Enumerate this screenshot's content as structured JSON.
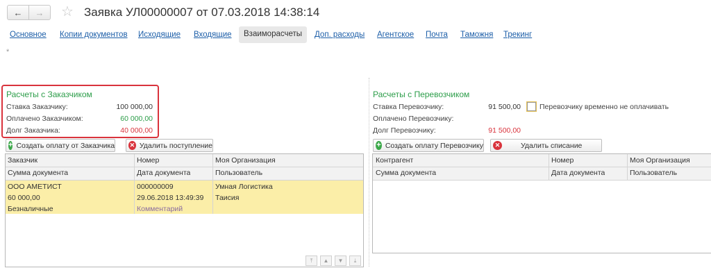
{
  "header": {
    "back_glyph": "←",
    "forward_glyph": "→",
    "star_glyph": "☆",
    "title": "Заявка УЛ00000007 от 07.03.2018 14:38:14"
  },
  "tabs": [
    {
      "label": "Основное"
    },
    {
      "label": "Копии документов"
    },
    {
      "label": "Исходящие"
    },
    {
      "label": "Входящие"
    },
    {
      "label": "Взаиморасчеты",
      "active": true
    },
    {
      "label": "Доп. расходы"
    },
    {
      "label": "Агентское"
    },
    {
      "label": "Почта"
    },
    {
      "label": "Таможня"
    },
    {
      "label": "Трекинг"
    }
  ],
  "asterisk": "*",
  "customer": {
    "title": "Расчеты с Заказчиком",
    "rate_label": "Ставка Заказчику:",
    "rate_value": "100 000,00",
    "paid_label": "Оплачено Заказчиком:",
    "paid_value": "60 000,00",
    "debt_label": "Долг Заказчика:",
    "debt_value": "40 000,00",
    "create_payment_button": "Создать оплату от Заказчика",
    "delete_receipt_button": "Удалить поступление",
    "columns_row1": [
      "Заказчик",
      "Номер",
      "Моя Организация"
    ],
    "columns_row2": [
      "Сумма документа",
      "Дата документа",
      "Пользователь"
    ],
    "record": {
      "customer": "ООО АМЕТИСТ",
      "number": "000000009",
      "organization": "Умная Логистика",
      "amount": "60 000,00",
      "date": "29.06.2018 13:49:39",
      "user": "Таисия",
      "payment_type": "Безналичные",
      "comment": "Комментарий"
    }
  },
  "carrier": {
    "title": "Расчеты с Перевозчиком",
    "rate_label": "Ставка Перевозчику:",
    "rate_value": "91 500,00",
    "no_pay_checkbox_label": "Перевозчику временно не оплачивать",
    "paid_label": "Оплачено Перевозчику:",
    "debt_label": "Долг Перевозчику:",
    "debt_value": "91 500,00",
    "create_payment_button": "Создать оплату Перевозчику",
    "delete_writeoff_button": "Удалить списание",
    "columns_row1": [
      "Контрагент",
      "Номер",
      "Моя Организация"
    ],
    "columns_row2": [
      "Сумма документа",
      "Дата документа",
      "Пользователь"
    ]
  },
  "colors": {
    "accent_green": "#2c9d49",
    "debt_red": "#d9333c",
    "link_blue": "#1c5ea8",
    "selection_yellow": "#fbeea8"
  }
}
